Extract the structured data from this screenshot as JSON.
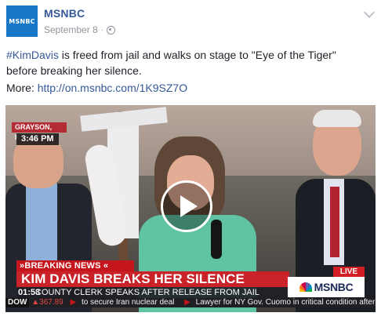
{
  "post": {
    "author": "MSNBC",
    "avatar_text": "MSNBC",
    "date": "September 8",
    "separator": "·",
    "hashtag": "#KimDavis",
    "message_rest": " is freed from jail and walks on stage to \"Eye of the Tiger\" before breaking her silence.",
    "more_label": "More: ",
    "link": "http://on.msnbc.com/1K9SZ7O"
  },
  "video": {
    "location": "GRAYSON, KY",
    "time": "3:46 PM",
    "breaking_label": "»BREAKING NEWS «",
    "headline": "KIM DAVIS BREAKS HER SILENCE",
    "subline": "COUNTY CLERK SPEAKS AFTER RELEASE FROM JAIL",
    "elapsed": "01:53",
    "live_label": "LIVE",
    "brand": "MSNBC",
    "ticker": {
      "dow_label": "DOW",
      "dow_value": "▲367.89",
      "item1": "to secure Iran nuclear deal",
      "item2": "Lawyer for NY Gov. Cuomo in critical condition after"
    }
  },
  "icons": {
    "globe": "globe-icon",
    "chevron": "chevron-down-icon",
    "play": "play-icon"
  },
  "colors": {
    "link": "#365899",
    "brand_blue": "#1877c9",
    "breaking_red": "#c4161c"
  }
}
